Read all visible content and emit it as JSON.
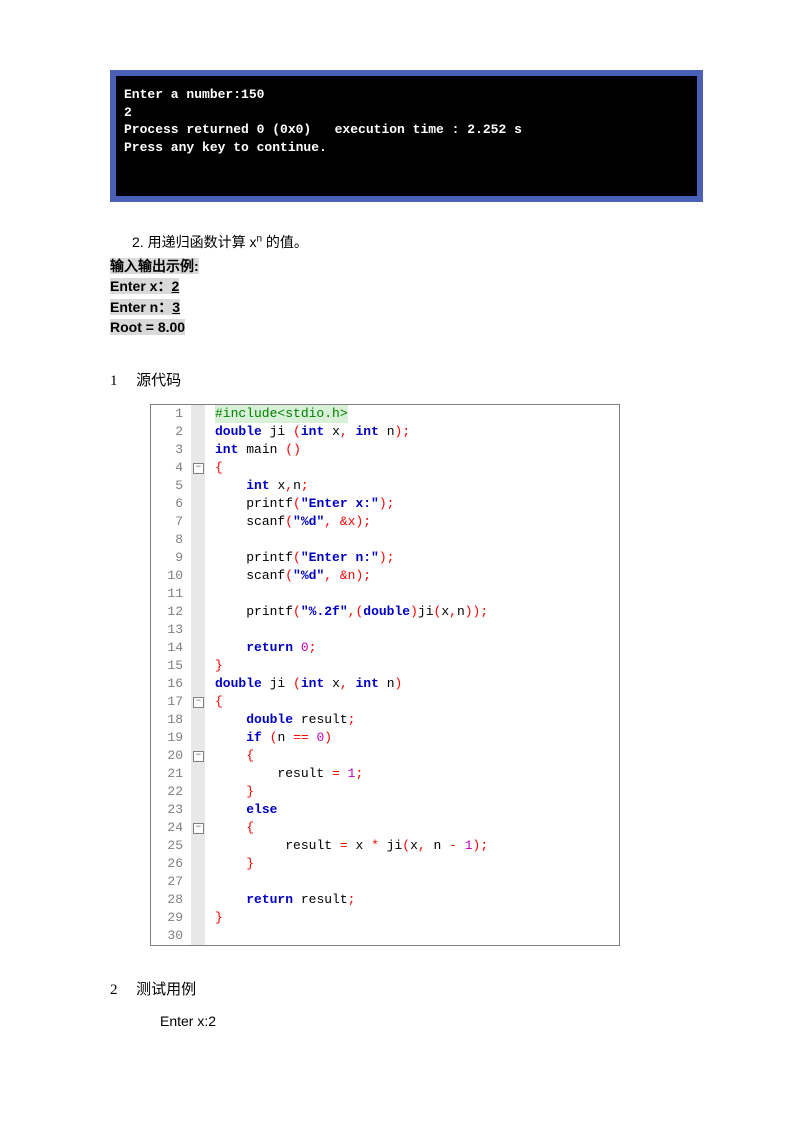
{
  "console": {
    "line1": "Enter a number:150",
    "line2": "2",
    "line3": "Process returned 0 (0x0)   execution time : 2.252 s",
    "line4": "Press any key to continue."
  },
  "problem": {
    "number": "2.",
    "desc_before": "用递归函数计算 x",
    "desc_sup": "n",
    "desc_after": " 的值。",
    "io_label": "输入输出示例:",
    "io_enter_x_lbl": "Enter   x：",
    "io_enter_x_val": "2",
    "io_enter_n_lbl": "Enter   n：",
    "io_enter_n_val": "3",
    "io_root_lbl": "Root   = ",
    "io_root_val": "8.00"
  },
  "sections": {
    "src_num": "1",
    "src_label": "源代码",
    "test_num": "2",
    "test_label": "测试用例"
  },
  "code": {
    "l1": {
      "ln": "1"
    },
    "l2": {
      "ln": "2"
    },
    "l3": {
      "ln": "3"
    },
    "l4": {
      "ln": "4"
    },
    "l5": {
      "ln": "5"
    },
    "l6": {
      "ln": "6"
    },
    "l7": {
      "ln": "7"
    },
    "l8": {
      "ln": "8"
    },
    "l9": {
      "ln": "9"
    },
    "l10": {
      "ln": "10"
    },
    "l11": {
      "ln": "11"
    },
    "l12": {
      "ln": "12"
    },
    "l13": {
      "ln": "13"
    },
    "l14": {
      "ln": "14"
    },
    "l15": {
      "ln": "15"
    },
    "l16": {
      "ln": "16"
    },
    "l17": {
      "ln": "17"
    },
    "l18": {
      "ln": "18"
    },
    "l19": {
      "ln": "19"
    },
    "l20": {
      "ln": "20"
    },
    "l21": {
      "ln": "21"
    },
    "l22": {
      "ln": "22"
    },
    "l23": {
      "ln": "23"
    },
    "l24": {
      "ln": "24"
    },
    "l25": {
      "ln": "25"
    },
    "l26": {
      "ln": "26"
    },
    "l27": {
      "ln": "27"
    },
    "l28": {
      "ln": "28"
    },
    "l29": {
      "ln": "29"
    },
    "l30": {
      "ln": "30"
    }
  },
  "tokens": {
    "include": "#include<stdio.h>",
    "double": "double",
    "int": "int",
    "main": "main",
    "ji": "ji",
    "printf": "printf",
    "scanf": "scanf",
    "return": "return",
    "if": "if",
    "else": "else",
    "result": "result",
    "x": "x",
    "n": "n",
    "str_enter_x": "\"Enter x:\"",
    "str_enter_n": "\"Enter n:\"",
    "str_pctd": "\"%d\"",
    "str_pct2f": "\"%.2f\"",
    "amp_x": "&x",
    "amp_n": "&n",
    "xn": "x,n",
    "zero": "0",
    "one": "1",
    "lbrace": "{",
    "rbrace": "}",
    "lparen": "(",
    "rparen": ")",
    "semi": ";",
    "comma": ", ",
    "eq": " = ",
    "deq": " == ",
    "star": " * ",
    "minus": " - ",
    "sp4": "    ",
    "sp8": "        ",
    "sp12": "            "
  },
  "test": {
    "line1": "Enter x:2"
  }
}
